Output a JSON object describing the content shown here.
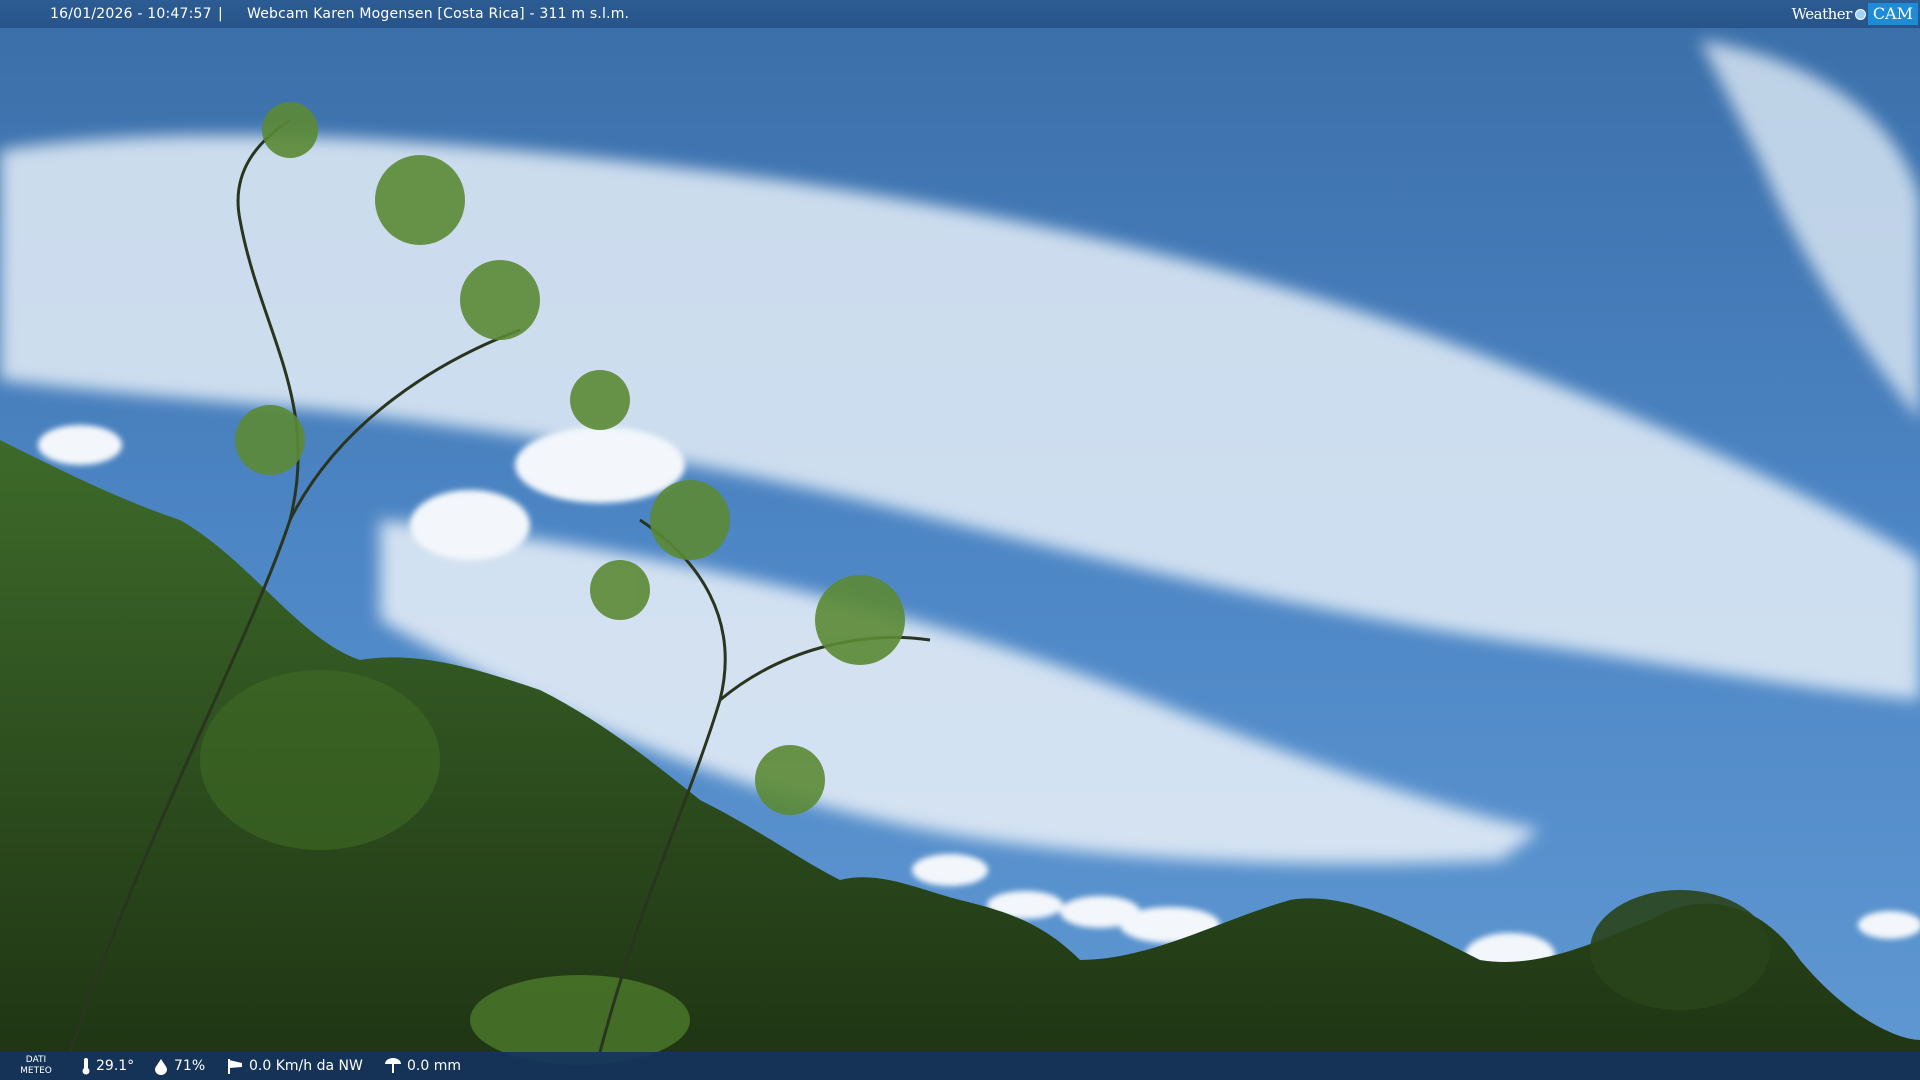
{
  "header": {
    "timestamp": "16/01/2026 - 10:47:57",
    "separator": "|",
    "title": "Webcam Karen Mogensen [Costa Rica] - 311 m s.l.m."
  },
  "brand": {
    "word1": "Weather",
    "word2": "CAM"
  },
  "footer": {
    "label_line1": "DATI",
    "label_line2": "METEO",
    "temperature": "29.1°",
    "humidity": "71%",
    "wind": "0.0 Km/h da NW",
    "rain": "0.0 mm"
  },
  "icons": {
    "temperature": "thermometer-icon",
    "humidity": "droplet-icon",
    "wind": "windsock-icon",
    "rain": "rain-gauge-icon"
  },
  "colors": {
    "sky_top": "#3a6ea8",
    "sky_bottom": "#5f98d2",
    "foliage": "#2d4a1e"
  }
}
